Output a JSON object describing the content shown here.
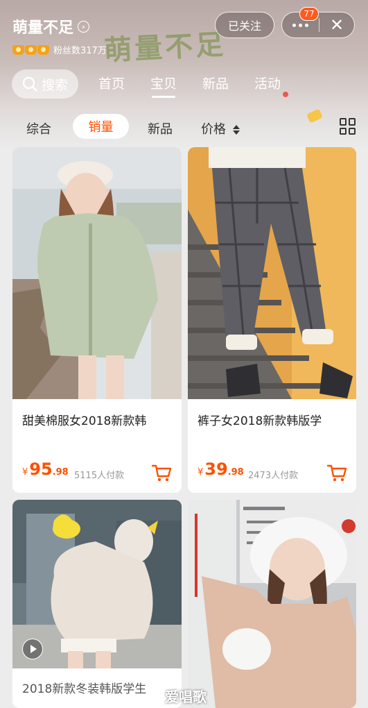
{
  "shop": {
    "name": "萌量不足",
    "followers": "粉丝数317万",
    "banner_text": "萌量不足",
    "follow_label": "已关注",
    "message_badge": "77"
  },
  "nav": {
    "search_label": "搜索",
    "tabs": [
      "首页",
      "宝贝",
      "新品",
      "活动"
    ],
    "active_tab": "宝贝"
  },
  "sort": {
    "items": [
      "综合",
      "销量",
      "新品",
      "价格"
    ],
    "active": "销量"
  },
  "products": [
    {
      "title": "甜美棉服女2018新款韩",
      "price_yen": "¥",
      "price_int": "95",
      "price_dec": ".98",
      "sold": "5115人付款"
    },
    {
      "title": "裤子女2018新款韩版学",
      "price_yen": "¥",
      "price_int": "39",
      "price_dec": ".98",
      "sold": "2473人付款"
    },
    {
      "title": "2018新款冬装韩版学生",
      "has_video": true
    },
    {
      "title": ""
    }
  ],
  "watermark": "爱唱歌",
  "colors": {
    "accent": "#ff5000",
    "badge": "#ff5a1f"
  }
}
